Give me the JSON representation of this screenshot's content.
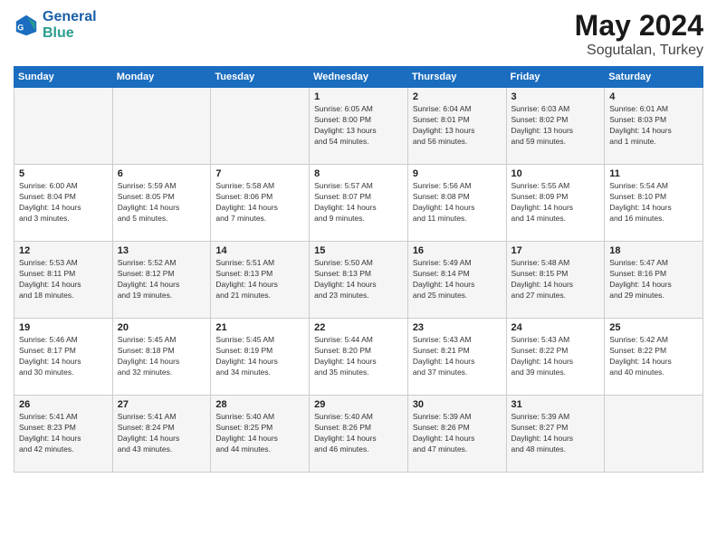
{
  "header": {
    "logo_line1": "General",
    "logo_line2": "Blue",
    "month": "May 2024",
    "location": "Sogutalan, Turkey"
  },
  "weekdays": [
    "Sunday",
    "Monday",
    "Tuesday",
    "Wednesday",
    "Thursday",
    "Friday",
    "Saturday"
  ],
  "weeks": [
    [
      {
        "day": "",
        "info": ""
      },
      {
        "day": "",
        "info": ""
      },
      {
        "day": "",
        "info": ""
      },
      {
        "day": "1",
        "info": "Sunrise: 6:05 AM\nSunset: 8:00 PM\nDaylight: 13 hours\nand 54 minutes."
      },
      {
        "day": "2",
        "info": "Sunrise: 6:04 AM\nSunset: 8:01 PM\nDaylight: 13 hours\nand 56 minutes."
      },
      {
        "day": "3",
        "info": "Sunrise: 6:03 AM\nSunset: 8:02 PM\nDaylight: 13 hours\nand 59 minutes."
      },
      {
        "day": "4",
        "info": "Sunrise: 6:01 AM\nSunset: 8:03 PM\nDaylight: 14 hours\nand 1 minute."
      }
    ],
    [
      {
        "day": "5",
        "info": "Sunrise: 6:00 AM\nSunset: 8:04 PM\nDaylight: 14 hours\nand 3 minutes."
      },
      {
        "day": "6",
        "info": "Sunrise: 5:59 AM\nSunset: 8:05 PM\nDaylight: 14 hours\nand 5 minutes."
      },
      {
        "day": "7",
        "info": "Sunrise: 5:58 AM\nSunset: 8:06 PM\nDaylight: 14 hours\nand 7 minutes."
      },
      {
        "day": "8",
        "info": "Sunrise: 5:57 AM\nSunset: 8:07 PM\nDaylight: 14 hours\nand 9 minutes."
      },
      {
        "day": "9",
        "info": "Sunrise: 5:56 AM\nSunset: 8:08 PM\nDaylight: 14 hours\nand 11 minutes."
      },
      {
        "day": "10",
        "info": "Sunrise: 5:55 AM\nSunset: 8:09 PM\nDaylight: 14 hours\nand 14 minutes."
      },
      {
        "day": "11",
        "info": "Sunrise: 5:54 AM\nSunset: 8:10 PM\nDaylight: 14 hours\nand 16 minutes."
      }
    ],
    [
      {
        "day": "12",
        "info": "Sunrise: 5:53 AM\nSunset: 8:11 PM\nDaylight: 14 hours\nand 18 minutes."
      },
      {
        "day": "13",
        "info": "Sunrise: 5:52 AM\nSunset: 8:12 PM\nDaylight: 14 hours\nand 19 minutes."
      },
      {
        "day": "14",
        "info": "Sunrise: 5:51 AM\nSunset: 8:13 PM\nDaylight: 14 hours\nand 21 minutes."
      },
      {
        "day": "15",
        "info": "Sunrise: 5:50 AM\nSunset: 8:13 PM\nDaylight: 14 hours\nand 23 minutes."
      },
      {
        "day": "16",
        "info": "Sunrise: 5:49 AM\nSunset: 8:14 PM\nDaylight: 14 hours\nand 25 minutes."
      },
      {
        "day": "17",
        "info": "Sunrise: 5:48 AM\nSunset: 8:15 PM\nDaylight: 14 hours\nand 27 minutes."
      },
      {
        "day": "18",
        "info": "Sunrise: 5:47 AM\nSunset: 8:16 PM\nDaylight: 14 hours\nand 29 minutes."
      }
    ],
    [
      {
        "day": "19",
        "info": "Sunrise: 5:46 AM\nSunset: 8:17 PM\nDaylight: 14 hours\nand 30 minutes."
      },
      {
        "day": "20",
        "info": "Sunrise: 5:45 AM\nSunset: 8:18 PM\nDaylight: 14 hours\nand 32 minutes."
      },
      {
        "day": "21",
        "info": "Sunrise: 5:45 AM\nSunset: 8:19 PM\nDaylight: 14 hours\nand 34 minutes."
      },
      {
        "day": "22",
        "info": "Sunrise: 5:44 AM\nSunset: 8:20 PM\nDaylight: 14 hours\nand 35 minutes."
      },
      {
        "day": "23",
        "info": "Sunrise: 5:43 AM\nSunset: 8:21 PM\nDaylight: 14 hours\nand 37 minutes."
      },
      {
        "day": "24",
        "info": "Sunrise: 5:43 AM\nSunset: 8:22 PM\nDaylight: 14 hours\nand 39 minutes."
      },
      {
        "day": "25",
        "info": "Sunrise: 5:42 AM\nSunset: 8:22 PM\nDaylight: 14 hours\nand 40 minutes."
      }
    ],
    [
      {
        "day": "26",
        "info": "Sunrise: 5:41 AM\nSunset: 8:23 PM\nDaylight: 14 hours\nand 42 minutes."
      },
      {
        "day": "27",
        "info": "Sunrise: 5:41 AM\nSunset: 8:24 PM\nDaylight: 14 hours\nand 43 minutes."
      },
      {
        "day": "28",
        "info": "Sunrise: 5:40 AM\nSunset: 8:25 PM\nDaylight: 14 hours\nand 44 minutes."
      },
      {
        "day": "29",
        "info": "Sunrise: 5:40 AM\nSunset: 8:26 PM\nDaylight: 14 hours\nand 46 minutes."
      },
      {
        "day": "30",
        "info": "Sunrise: 5:39 AM\nSunset: 8:26 PM\nDaylight: 14 hours\nand 47 minutes."
      },
      {
        "day": "31",
        "info": "Sunrise: 5:39 AM\nSunset: 8:27 PM\nDaylight: 14 hours\nand 48 minutes."
      },
      {
        "day": "",
        "info": ""
      }
    ]
  ]
}
